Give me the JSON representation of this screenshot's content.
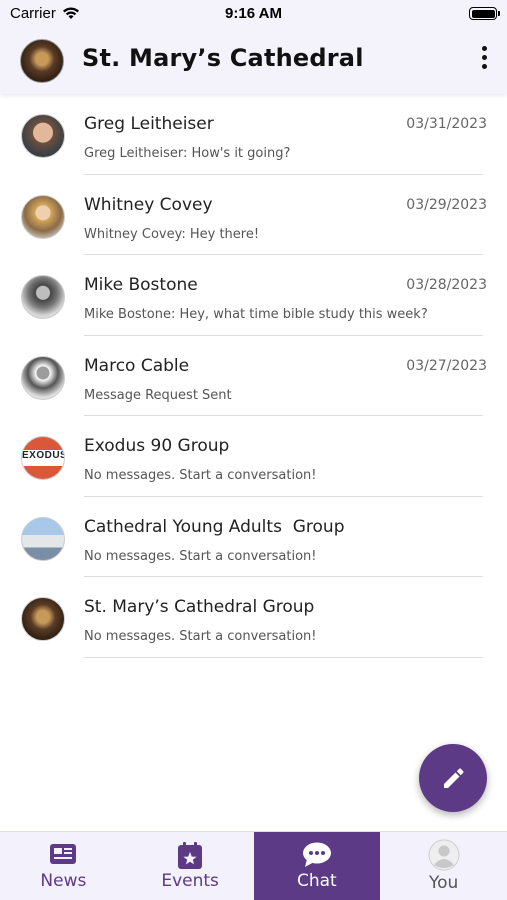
{
  "status_bar": {
    "carrier": "Carrier",
    "time": "9:16 AM"
  },
  "header": {
    "title": "St. Mary’s Cathedral"
  },
  "chats": [
    {
      "name": "Greg Leitheiser",
      "date": "03/31/2023",
      "preview": "Greg Leitheiser: How's it going?"
    },
    {
      "name": "Whitney Covey",
      "date": "03/29/2023",
      "preview": "Whitney Covey: Hey there!"
    },
    {
      "name": "Mike Bostone",
      "date": "03/28/2023",
      "preview": "Mike Bostone: Hey, what time bible study this week?"
    },
    {
      "name": "Marco Cable",
      "date": "03/27/2023",
      "preview": "Message Request Sent"
    },
    {
      "name": "Exodus 90 Group",
      "date": "",
      "preview": "No messages. Start a conversation!",
      "avatar_text": "EXODUS"
    },
    {
      "name": "Cathedral Young Adults  Group",
      "date": "",
      "preview": "No messages. Start a conversation!"
    },
    {
      "name": "St. Mary’s Cathedral Group",
      "date": "",
      "preview": "No messages. Start a conversation!"
    }
  ],
  "fab": {
    "icon": "pencil-icon"
  },
  "tabs": [
    {
      "label": "News",
      "icon": "newspaper-icon"
    },
    {
      "label": "Events",
      "icon": "calendar-star-icon"
    },
    {
      "label": "Chat",
      "icon": "chat-bubble-icon",
      "active": true
    },
    {
      "label": "You",
      "icon": "user-avatar-icon"
    }
  ],
  "colors": {
    "accent": "#5c3a85",
    "header_bg": "#f4f3fb",
    "tabbar_bg": "#f3f1fb"
  }
}
